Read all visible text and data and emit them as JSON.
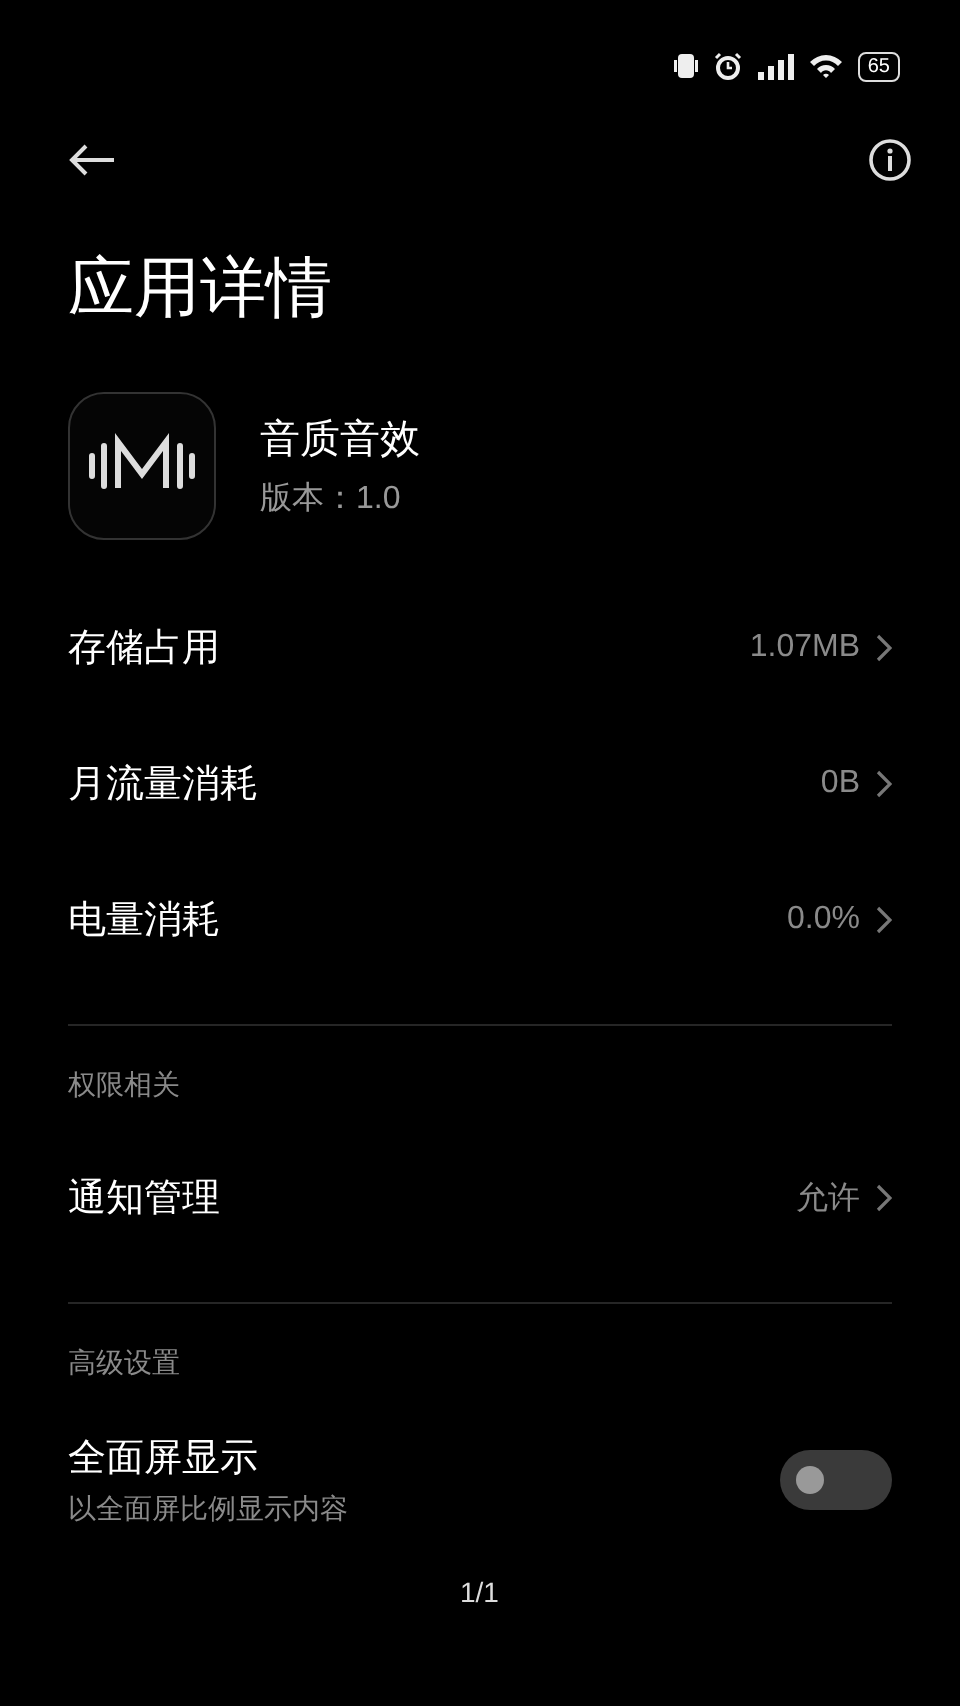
{
  "status_bar": {
    "battery": "65"
  },
  "page_indicator": "1/1",
  "header": {
    "title": "应用详情"
  },
  "app": {
    "name": "音质音效",
    "version": "版本：1.0"
  },
  "sections": [
    {
      "items": [
        {
          "kind": "link",
          "label": "存储占用",
          "value": "1.07MB"
        },
        {
          "kind": "link",
          "label": "月流量消耗",
          "value": "0B"
        },
        {
          "kind": "link",
          "label": "电量消耗",
          "value": "0.0%"
        }
      ]
    },
    {
      "title": "权限相关",
      "items": [
        {
          "kind": "link",
          "label": "通知管理",
          "value": "允许"
        }
      ]
    },
    {
      "title": "高级设置",
      "items": [
        {
          "kind": "toggle",
          "label": "全面屏显示",
          "subtitle": "以全面屏比例显示内容",
          "on": false
        }
      ]
    }
  ]
}
